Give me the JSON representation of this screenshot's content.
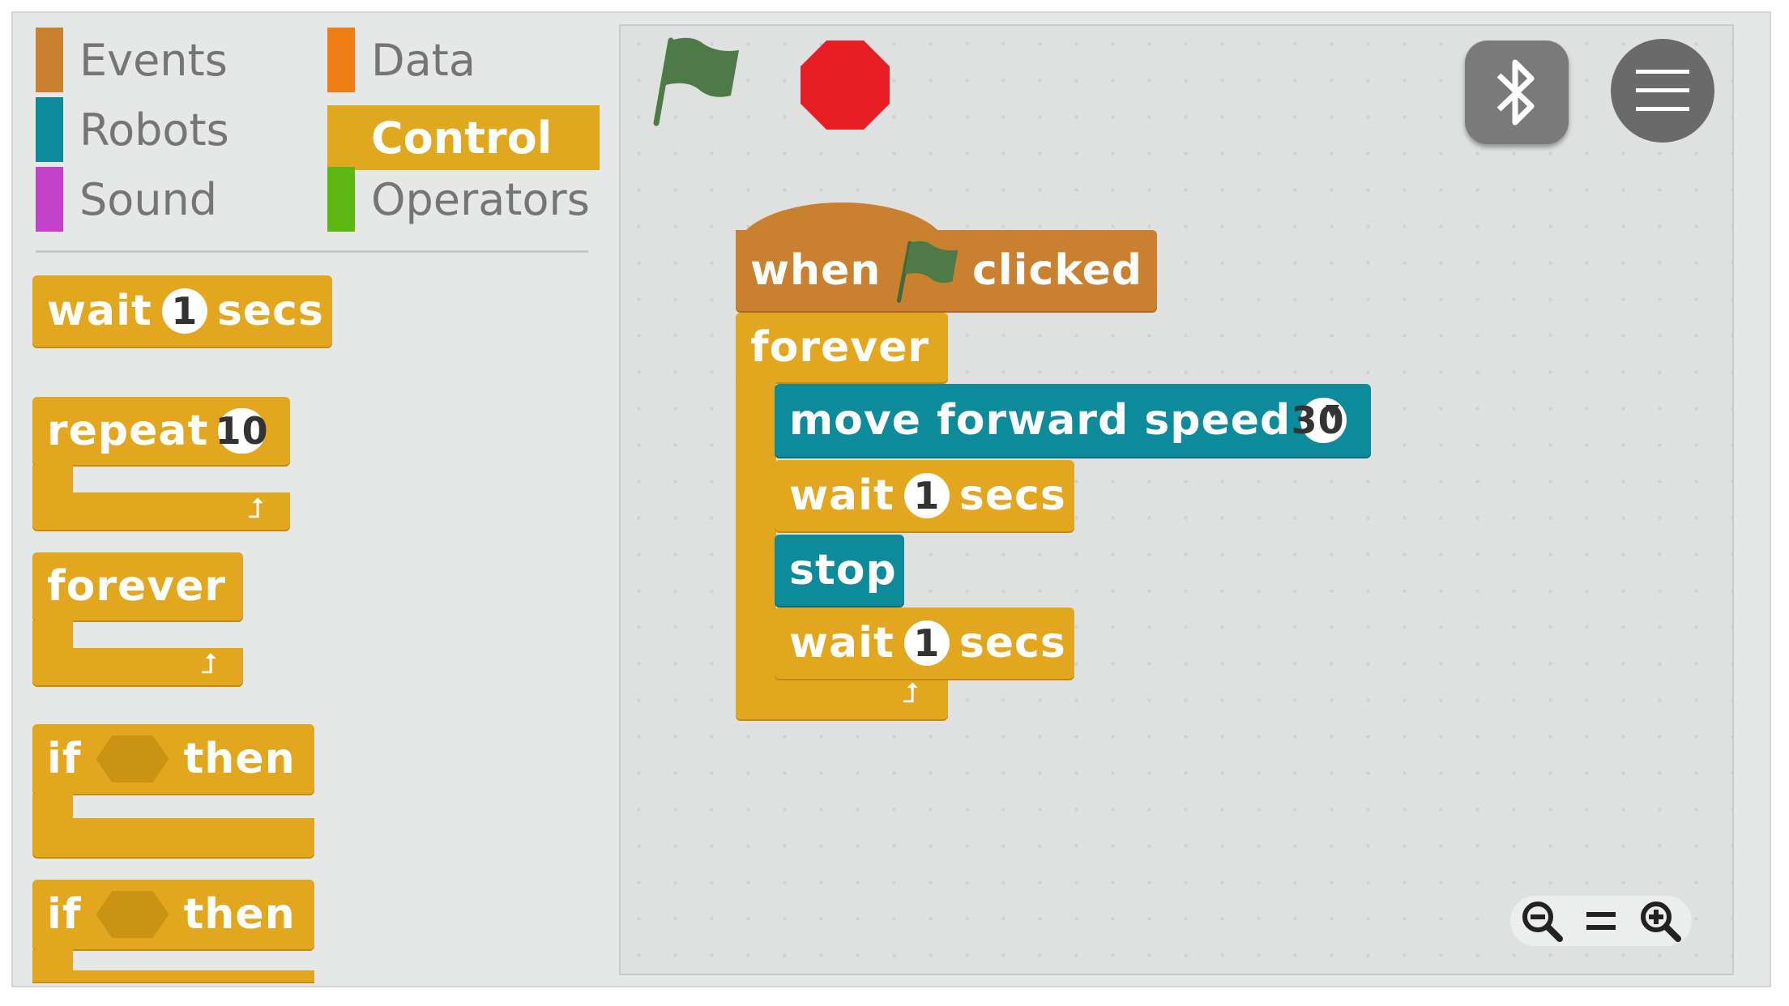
{
  "categories": {
    "events": {
      "label": "Events",
      "color": "#c9812f"
    },
    "robots": {
      "label": "Robots",
      "color": "#0d8b9a"
    },
    "sound": {
      "label": "Sound",
      "color": "#c442c8"
    },
    "data": {
      "label": "Data",
      "color": "#ee7d16"
    },
    "control": {
      "label": "Control",
      "color": "#e0a81e"
    },
    "operators": {
      "label": "Operators",
      "color": "#5cb712"
    }
  },
  "palette": {
    "wait": {
      "label": "wait",
      "value": "1",
      "unit": "secs"
    },
    "repeat": {
      "label": "repeat",
      "value": "10"
    },
    "forever": {
      "label": "forever"
    },
    "if1": {
      "label": "if",
      "then": "then"
    },
    "if2": {
      "label": "if",
      "then": "then"
    }
  },
  "script": {
    "hat_when": "when",
    "hat_clicked": "clicked",
    "forever": "forever",
    "move_label": "move forward speed",
    "move_value": "30",
    "wait1_label": "wait",
    "wait1_value": "1",
    "wait1_unit": "secs",
    "stop": "stop",
    "wait2_label": "wait",
    "wait2_value": "1",
    "wait2_unit": "secs"
  },
  "icons": {
    "green_flag": "green-flag-icon",
    "stop": "stop-sign-icon",
    "bluetooth": "bluetooth-icon",
    "menu": "hamburger-menu-icon",
    "zoom_out": "zoom-out-icon",
    "zoom_reset": "equals-icon",
    "zoom_in": "zoom-in-icon"
  },
  "colors": {
    "control": "#e3a71f",
    "robots": "#0d8b9a",
    "events": "#c9812f",
    "stop_red": "#e81e25",
    "flag_green": "#4e7a47"
  }
}
